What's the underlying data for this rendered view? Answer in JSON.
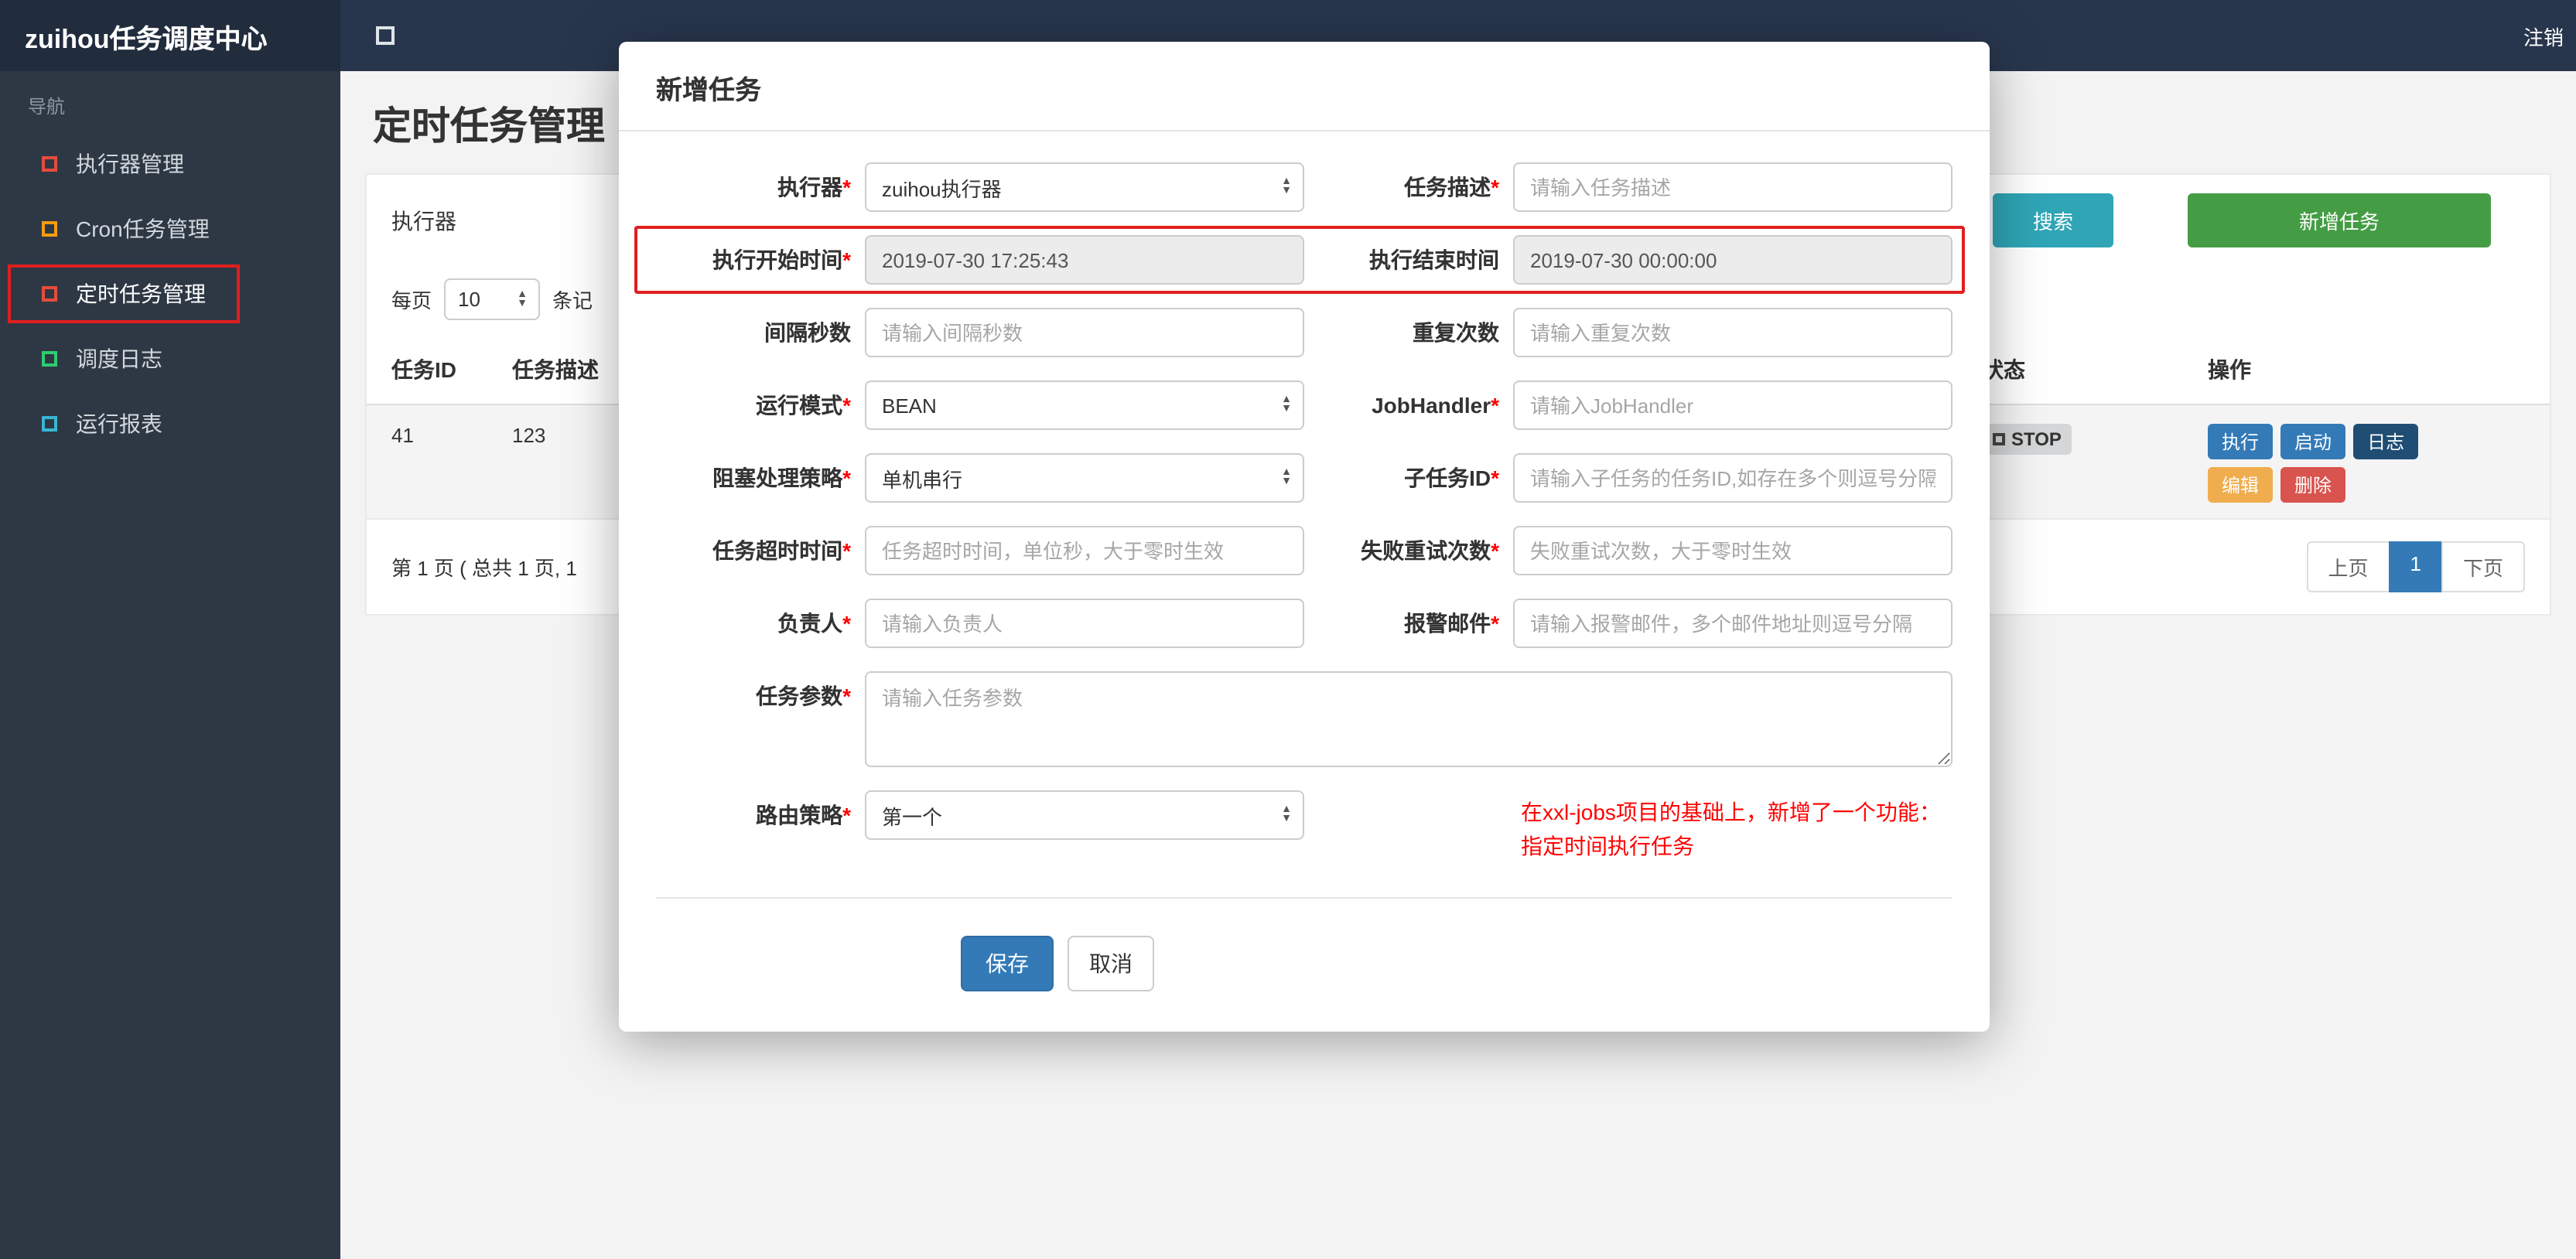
{
  "colors": {
    "topbar": "#28364d",
    "sidebar": "#2e3844",
    "accent_blue": "#337ab7",
    "search_teal": "#2fa5b6",
    "add_green": "#449d44",
    "log_navy": "#204d74",
    "edit_orange": "#f0ad4e",
    "delete_red": "#d9534f",
    "annotation_red": "#e01f1f",
    "note_red": "#ff0000"
  },
  "header": {
    "brand": "zuihou任务调度中心",
    "logout_label": "注销"
  },
  "sidebar": {
    "section_label": "导航",
    "items": [
      {
        "label": "执行器管理"
      },
      {
        "label": "Cron任务管理"
      },
      {
        "label": "定时任务管理"
      },
      {
        "label": "调度日志"
      },
      {
        "label": "运行报表"
      }
    ]
  },
  "page": {
    "title": "定时任务管理",
    "toolbar": {
      "filter_label": "执行器",
      "search_label": "搜索",
      "add_label": "新增任务"
    },
    "per_page": {
      "prefix": "每页",
      "value": "10",
      "suffix": "条记"
    },
    "table": {
      "col_id": "任务ID",
      "col_desc": "任务描述",
      "col_status": "状态",
      "col_actions": "操作",
      "row": {
        "id": "41",
        "desc": "123",
        "status": "STOP",
        "btn_execute": "执行",
        "btn_start": "启动",
        "btn_log": "日志",
        "btn_edit": "编辑",
        "btn_delete": "删除"
      },
      "summary": "第 1 页 ( 总共 1 页, 1",
      "prev_label": "上页",
      "current_page": "1",
      "next_label": "下页"
    }
  },
  "modal": {
    "title": "新增任务",
    "save_label": "保存",
    "cancel_label": "取消",
    "note_line1": "在xxl-jobs项目的基础上，新增了一个功能：",
    "note_line2": "指定时间执行任务",
    "fields": {
      "executor": {
        "label": "执行器",
        "required": "*",
        "value": "zuihou执行器"
      },
      "desc": {
        "label": "任务描述",
        "required": "*",
        "placeholder": "请输入任务描述"
      },
      "start_time": {
        "label": "执行开始时间",
        "required": "*",
        "value": "2019-07-30 17:25:43"
      },
      "end_time": {
        "label": "执行结束时间",
        "value": "2019-07-30 00:00:00"
      },
      "interval": {
        "label": "间隔秒数",
        "placeholder": "请输入间隔秒数"
      },
      "repeat": {
        "label": "重复次数",
        "placeholder": "请输入重复次数"
      },
      "run_mode": {
        "label": "运行模式",
        "required": "*",
        "value": "BEAN"
      },
      "job_handler": {
        "label": "JobHandler",
        "required": "*",
        "placeholder": "请输入JobHandler"
      },
      "block_strategy": {
        "label": "阻塞处理策略",
        "required": "*",
        "value": "单机串行"
      },
      "child_job": {
        "label": "子任务ID",
        "required": "*",
        "placeholder": "请输入子任务的任务ID,如存在多个则逗号分隔"
      },
      "timeout": {
        "label": "任务超时时间",
        "required": "*",
        "placeholder": "任务超时时间，单位秒，大于零时生效"
      },
      "retry": {
        "label": "失败重试次数",
        "required": "*",
        "placeholder": "失败重试次数，大于零时生效"
      },
      "owner": {
        "label": "负责人",
        "required": "*",
        "placeholder": "请输入负责人"
      },
      "alarm_email": {
        "label": "报警邮件",
        "required": "*",
        "placeholder": "请输入报警邮件，多个邮件地址则逗号分隔"
      },
      "params": {
        "label": "任务参数",
        "required": "*",
        "placeholder": "请输入任务参数"
      },
      "route_strategy": {
        "label": "路由策略",
        "required": "*",
        "value": "第一个"
      }
    }
  }
}
